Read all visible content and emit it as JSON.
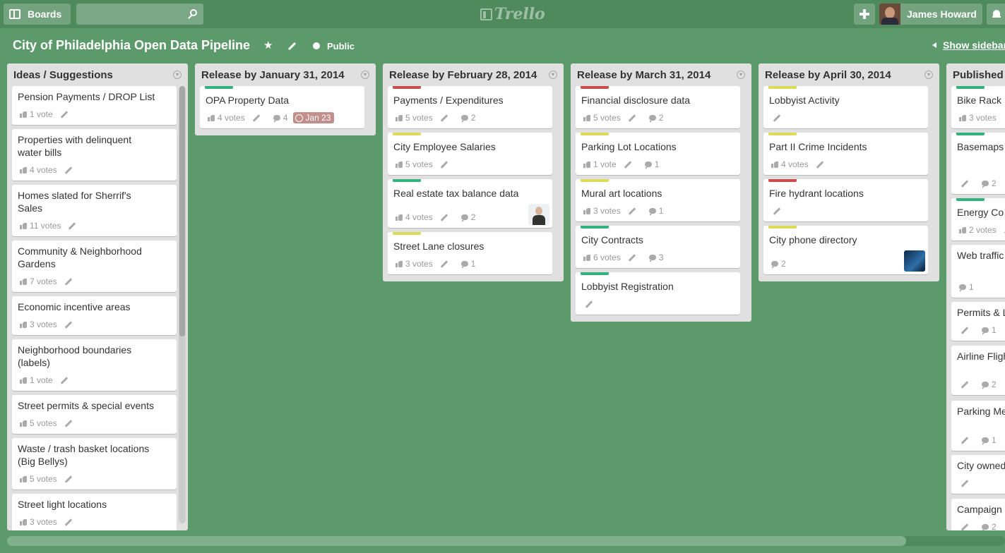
{
  "header": {
    "boards_label": "Boards",
    "search_placeholder": "",
    "logo_text": "Trello",
    "user_name": "James Howard"
  },
  "board": {
    "title": "City of Philadelphia Open Data Pipeline",
    "visibility": "Public",
    "show_sidebar": "Show sidebar"
  },
  "colors": {
    "background": "#5d9a6b",
    "header": "#4e8a5c",
    "green_label": "#34b27d",
    "red_label": "#cb4d4d",
    "yellow_label": "#dbdb57",
    "due_badge": "#c18e8c"
  },
  "lists": [
    {
      "title": "Ideas / Suggestions",
      "cards": [
        {
          "title": "Pension Payments / DROP List",
          "votes": "1 vote",
          "edit": true
        },
        {
          "title": "Properties with delinquent water bills",
          "votes": "4 votes",
          "edit": true
        },
        {
          "title": "Homes slated for Sherrif's Sales",
          "votes": "11 votes",
          "edit": true
        },
        {
          "title": "Community & Neighborhood Gardens",
          "votes": "7 votes",
          "edit": true
        },
        {
          "title": "Economic incentive areas",
          "votes": "3 votes",
          "edit": true
        },
        {
          "title": "Neighborhood boundaries (labels)",
          "votes": "1 vote",
          "edit": true
        },
        {
          "title": "Street permits & special events",
          "votes": "5 votes",
          "edit": true
        },
        {
          "title": "Waste / trash basket locations (Big Bellys)",
          "votes": "5 votes",
          "edit": true
        },
        {
          "title": "Street light locations",
          "votes": "3 votes",
          "edit": true
        }
      ]
    },
    {
      "title": "Release by January 31, 2014",
      "cards": [
        {
          "title": "OPA Property Data",
          "label": "green",
          "votes": "4 votes",
          "edit": true,
          "comments": "4",
          "due": "Jan 23"
        }
      ]
    },
    {
      "title": "Release by February 28, 2014",
      "cards": [
        {
          "title": "Payments / Expenditures",
          "label": "red",
          "votes": "5 votes",
          "edit": true,
          "comments": "2"
        },
        {
          "title": "City Employee Salaries",
          "label": "yellow",
          "votes": "5 votes",
          "edit": true
        },
        {
          "title": "Real estate tax balance data",
          "label": "green",
          "votes": "4 votes",
          "edit": true,
          "comments": "2",
          "avatar": "person"
        },
        {
          "title": "Street Lane closures",
          "label": "yellow",
          "votes": "3 votes",
          "edit": true,
          "comments": "1"
        }
      ]
    },
    {
      "title": "Release by March 31, 2014",
      "cards": [
        {
          "title": "Financial disclosure data",
          "label": "red",
          "votes": "5 votes",
          "edit": true,
          "comments": "2"
        },
        {
          "title": "Parking Lot Locations",
          "label": "yellow",
          "votes": "1 vote",
          "edit": true,
          "comments": "1"
        },
        {
          "title": "Mural art locations",
          "label": "yellow",
          "votes": "3 votes",
          "edit": true,
          "comments": "1"
        },
        {
          "title": "City Contracts",
          "label": "green",
          "votes": "6 votes",
          "edit": true,
          "comments": "3"
        },
        {
          "title": "Lobbyist Registration",
          "label": "green",
          "edit": true
        }
      ]
    },
    {
      "title": "Release by April 30, 2014",
      "cards": [
        {
          "title": "Lobbyist Activity",
          "label": "yellow",
          "edit": true
        },
        {
          "title": "Part II Crime Incidents",
          "label": "yellow",
          "votes": "4 votes",
          "edit": true
        },
        {
          "title": "Fire hydrant locations",
          "label": "red",
          "edit": true
        },
        {
          "title": "City phone directory",
          "label": "yellow",
          "comments": "2",
          "avatar": "dark"
        }
      ]
    },
    {
      "title": "Published",
      "cards": [
        {
          "title": "Bike Rack",
          "label": "green",
          "votes": "3 votes"
        },
        {
          "title": "Basemaps cached in",
          "label": "green",
          "edit": true,
          "comments": "2"
        },
        {
          "title": "Energy Co",
          "label": "green",
          "votes": "2 votes",
          "edit": true
        },
        {
          "title": "Web traffic websites.",
          "comments": "1"
        },
        {
          "title": "Permits & L",
          "edit": true,
          "comments": "1"
        },
        {
          "title": "Airline Fligh (Arrivals &",
          "edit": true,
          "comments": "2"
        },
        {
          "title": "Parking Me Locations",
          "edit": true,
          "comments": "1"
        },
        {
          "title": "City owned",
          "edit": true
        },
        {
          "title": "Campaign",
          "edit": true,
          "comments": "2"
        }
      ]
    }
  ]
}
